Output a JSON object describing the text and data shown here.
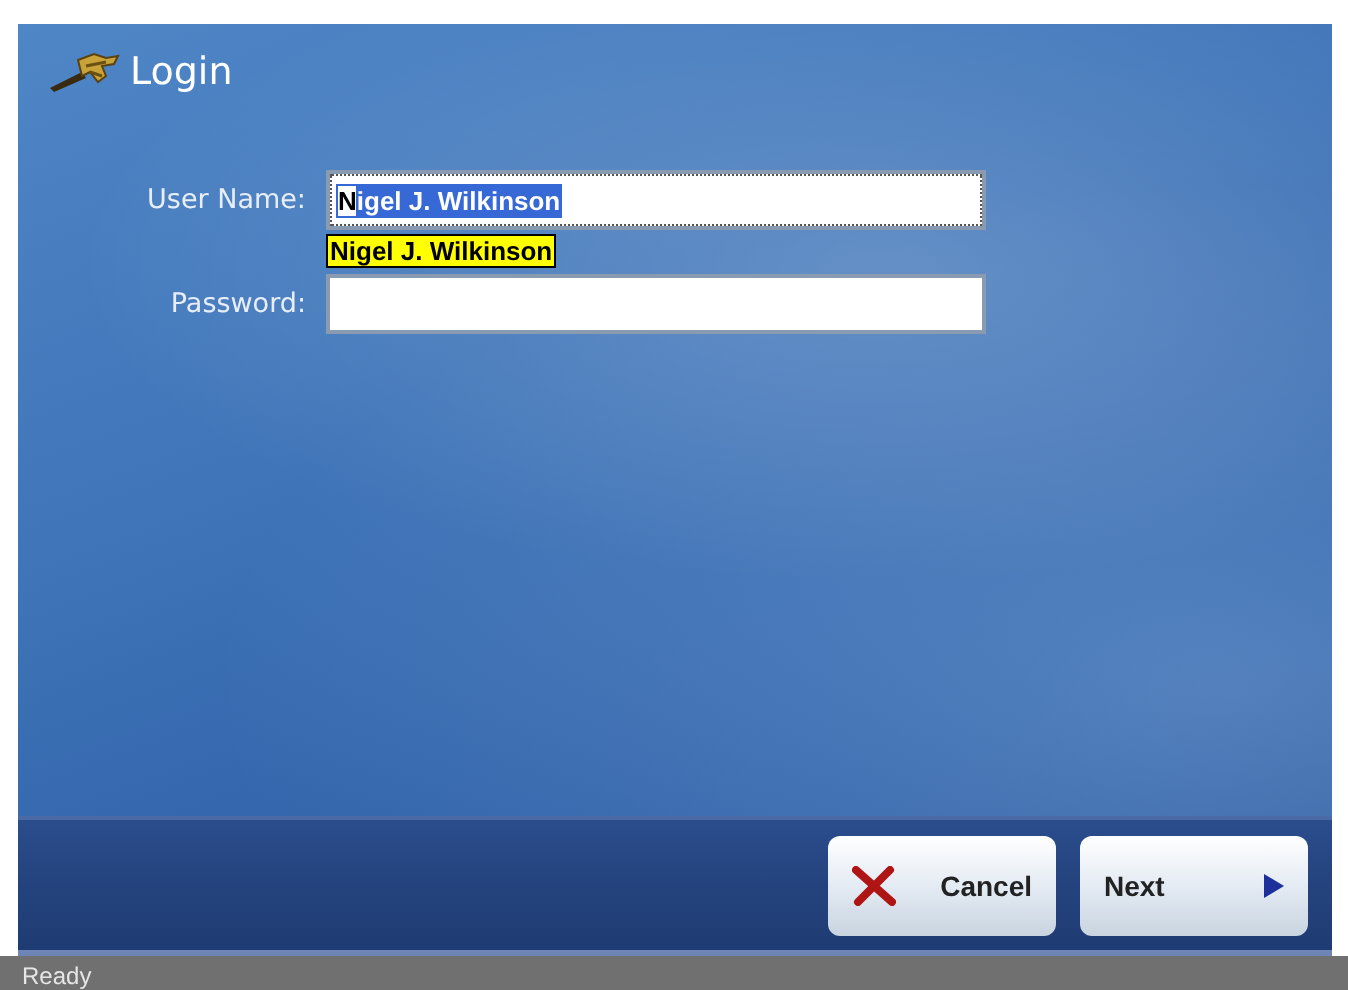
{
  "window": {
    "title": "Login"
  },
  "form": {
    "fields": [
      {
        "kind": "text",
        "label": "User Name:",
        "value": "Nigel J. Wilkinson",
        "selected": true,
        "suggestion": "Nigel J. Wilkinson"
      },
      {
        "kind": "password",
        "label": "Password:"
      }
    ]
  },
  "buttons": [
    {
      "kind": "cancel",
      "label": "Cancel"
    },
    {
      "kind": "next",
      "label": "Next"
    }
  ],
  "status_bar": {
    "text": "Ready"
  }
}
